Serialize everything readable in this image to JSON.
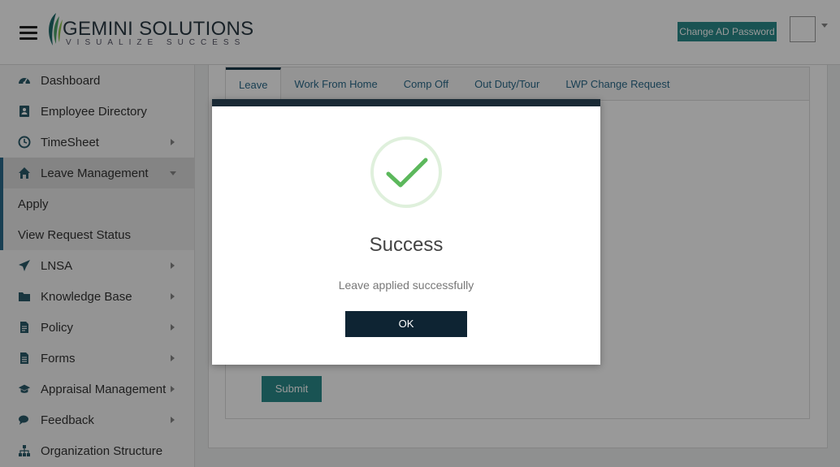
{
  "header": {
    "logo_main": "GEMINI SOLUTIONS",
    "logo_tagline": "VISUALIZE SUCCESS",
    "change_password_label": "Change AD Password"
  },
  "sidebar": {
    "items": [
      {
        "label": "Dashboard",
        "icon": "dashboard-icon",
        "has_arrow": false
      },
      {
        "label": "Employee Directory",
        "icon": "directory-icon",
        "has_arrow": false
      },
      {
        "label": "TimeSheet",
        "icon": "clock-icon",
        "has_arrow": true
      },
      {
        "label": "Leave Management",
        "icon": "home-icon",
        "has_arrow": true,
        "expanded": true
      },
      {
        "label": "LNSA",
        "icon": "paper-plane-icon",
        "has_arrow": true
      },
      {
        "label": "Knowledge Base",
        "icon": "folder-icon",
        "has_arrow": true
      },
      {
        "label": "Policy",
        "icon": "document-icon",
        "has_arrow": true
      },
      {
        "label": "Forms",
        "icon": "form-icon",
        "has_arrow": true
      },
      {
        "label": "Appraisal Management",
        "icon": "graduation-cap-icon",
        "has_arrow": true
      },
      {
        "label": "Feedback",
        "icon": "comments-icon",
        "has_arrow": true
      },
      {
        "label": "Organization Structure",
        "icon": "sitemap-icon",
        "has_arrow": false
      }
    ],
    "leave_subitems": [
      "Apply",
      "View Request Status"
    ]
  },
  "tabs": [
    "Leave",
    "Work From Home",
    "Comp Off",
    "Out Duty/Tour",
    "LWP Change Request"
  ],
  "form": {
    "submit_label": "Submit"
  },
  "modal": {
    "title": "Success",
    "message": "Leave applied successfully",
    "ok_label": "OK"
  },
  "colors": {
    "accent": "#2a8a8a",
    "modal_header": "#1a2a35",
    "ok_button": "#0e2433",
    "check_green": "#5cb85c"
  }
}
